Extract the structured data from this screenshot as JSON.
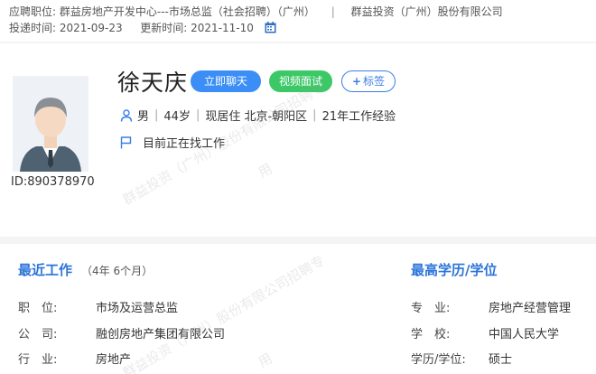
{
  "header": {
    "applied_position_label": "应聘职位:",
    "applied_position": "群益房地产开发中心---市场总监（社会招聘）（广州）",
    "separator": "|",
    "company": "群益投资（广州）股份有限公司",
    "apply_time_label": "投递时间:",
    "apply_time": "2021-09-23",
    "update_time_label": "更新时间:",
    "update_time": "2021-11-10",
    "calendar_icon": "calendar-icon"
  },
  "profile": {
    "name": "徐天庆",
    "chat_button": "立即聊天",
    "video_button": "视频面试",
    "tag_button_plus": "+",
    "tag_button": "标签",
    "id_label": "ID:890378970",
    "gender": "男",
    "age": "44岁",
    "residence": "现居住 北京-朝阳区",
    "experience": "21年工作经验",
    "bar": "|",
    "job_status": "目前正在找工作",
    "icons": {
      "person": "person-icon",
      "flag": "flag-icon",
      "avatar": "avatar"
    },
    "accent_color": "#3a8ef6",
    "video_color": "#3cc867"
  },
  "watermark": {
    "line1": "群益投资（广州）股份有限公司招聘专",
    "line2": "用"
  },
  "recent_work": {
    "title": "最近工作",
    "duration": "（4年 6个月）",
    "rows": [
      {
        "key": "职　位:",
        "value": "市场及运营总监"
      },
      {
        "key": "公　司:",
        "value": "融创房地产集团有限公司"
      },
      {
        "key": "行　业:",
        "value": "房地产"
      }
    ]
  },
  "education": {
    "title": "最高学历/学位",
    "rows": [
      {
        "key": "专　业:",
        "value": "房地产经营管理"
      },
      {
        "key": "学　校:",
        "value": "中国人民大学"
      },
      {
        "key": "学历/学位:",
        "value": "硕士"
      }
    ]
  }
}
